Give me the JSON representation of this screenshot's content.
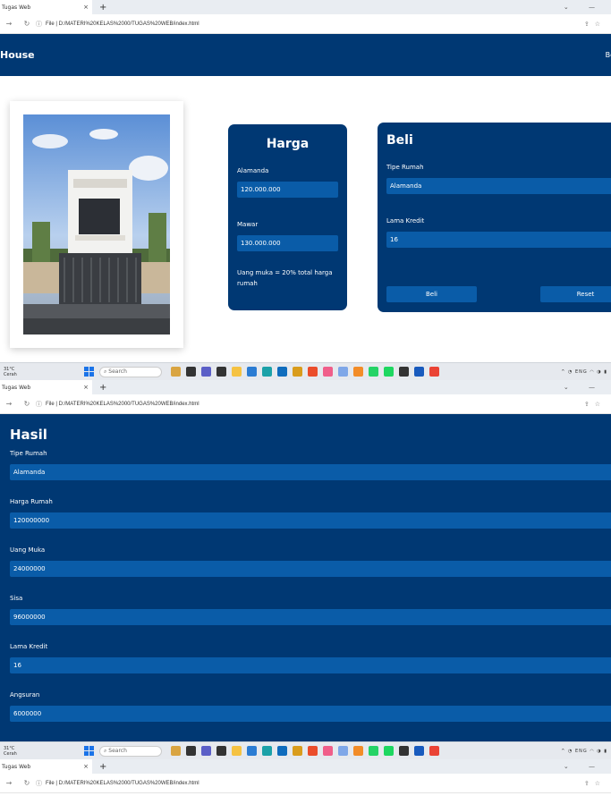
{
  "browser": {
    "tab_title": "Tugas Web",
    "tab_close": "×",
    "new_tab": "+",
    "address_label": "File",
    "url": "D:/MATERI%20KELAS%2000/TUGAS%20WEB/index.html"
  },
  "taskbar": {
    "temp": "31°C",
    "weather": "Cerah",
    "search": "Search",
    "lang": "ENG"
  },
  "page1": {
    "brand": "House",
    "nav_link": "Be",
    "harga": {
      "title": "Harga",
      "items": [
        {
          "label": "Alamanda",
          "value": "120.000.000"
        },
        {
          "label": "Mawar",
          "value": "130.000.000"
        }
      ],
      "note": "Uang muka = 20% total harga rumah"
    },
    "beli": {
      "title": "Beli",
      "tipe_label": "Tipe Rumah",
      "tipe_value": "Alamanda",
      "lama_label": "Lama Kredit",
      "lama_value": "16",
      "beli_button": "Beli",
      "reset_button": "Reset"
    }
  },
  "page2": {
    "title": "Hasil",
    "rows": [
      {
        "label": "Tipe Rumah",
        "value": "Alamanda"
      },
      {
        "label": "Harga Rumah",
        "value": "120000000"
      },
      {
        "label": "Uang Muka",
        "value": "24000000"
      },
      {
        "label": "Sisa",
        "value": "96000000"
      },
      {
        "label": "Lama Kredit",
        "value": "16"
      },
      {
        "label": "Angsuran",
        "value": "6000000"
      }
    ]
  },
  "colors": {
    "navy": "#003873",
    "field": "#0a5ca8"
  }
}
